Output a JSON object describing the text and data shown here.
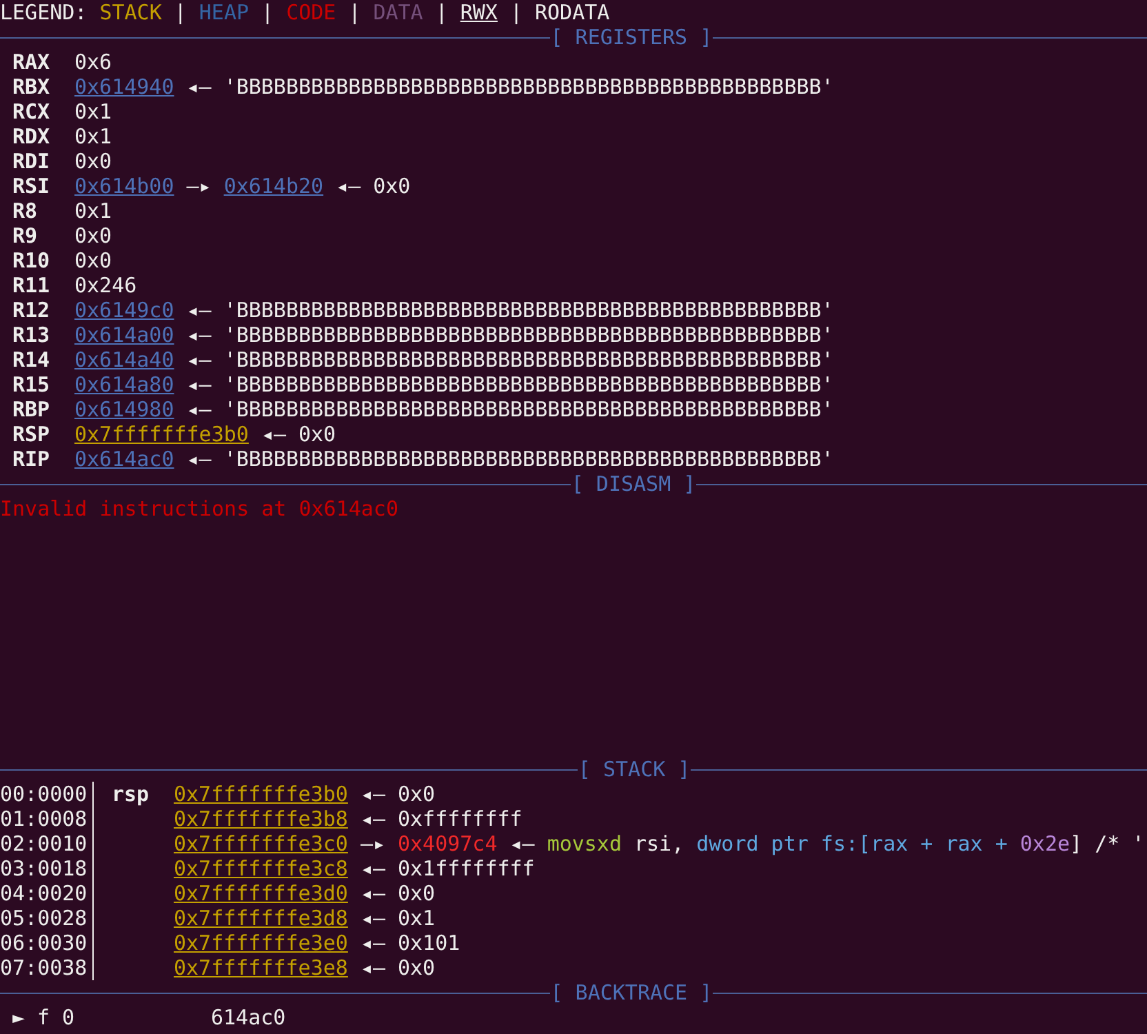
{
  "legend": {
    "label": "LEGEND:",
    "items": [
      {
        "text": "STACK",
        "kind": "stack"
      },
      {
        "text": "|",
        "kind": "sep"
      },
      {
        "text": "HEAP",
        "kind": "heap"
      },
      {
        "text": "|",
        "kind": "sep"
      },
      {
        "text": "CODE",
        "kind": "code"
      },
      {
        "text": "|",
        "kind": "sep"
      },
      {
        "text": "DATA",
        "kind": "data"
      },
      {
        "text": "|",
        "kind": "sep"
      },
      {
        "text": "RWX",
        "kind": "rwx"
      },
      {
        "text": "|",
        "kind": "sep"
      },
      {
        "text": "RODATA",
        "kind": "rodata"
      }
    ]
  },
  "registers": {
    "title": "[ REGISTERS ]",
    "rows": [
      {
        "name": "RAX",
        "chain": [
          {
            "text": "0x6",
            "kind": "plain"
          }
        ]
      },
      {
        "name": "RBX",
        "chain": [
          {
            "text": "0x614940",
            "kind": "heap"
          },
          {
            "text": "◂—",
            "kind": "arrow"
          },
          {
            "text": "'BBBBBBBBBBBBBBBBBBBBBBBBBBBBBBBBBBBBBBBBBBBBBBB'",
            "kind": "plain"
          }
        ]
      },
      {
        "name": "RCX",
        "chain": [
          {
            "text": "0x1",
            "kind": "plain"
          }
        ]
      },
      {
        "name": "RDX",
        "chain": [
          {
            "text": "0x1",
            "kind": "plain"
          }
        ]
      },
      {
        "name": "RDI",
        "chain": [
          {
            "text": "0x0",
            "kind": "plain"
          }
        ]
      },
      {
        "name": "RSI",
        "chain": [
          {
            "text": "0x614b00",
            "kind": "heap"
          },
          {
            "text": "—▸",
            "kind": "arrow"
          },
          {
            "text": "0x614b20",
            "kind": "heap"
          },
          {
            "text": "◂—",
            "kind": "arrow"
          },
          {
            "text": "0x0",
            "kind": "plain"
          }
        ]
      },
      {
        "name": "R8",
        "chain": [
          {
            "text": "0x1",
            "kind": "plain"
          }
        ]
      },
      {
        "name": "R9",
        "chain": [
          {
            "text": "0x0",
            "kind": "plain"
          }
        ]
      },
      {
        "name": "R10",
        "chain": [
          {
            "text": "0x0",
            "kind": "plain"
          }
        ]
      },
      {
        "name": "R11",
        "chain": [
          {
            "text": "0x246",
            "kind": "plain"
          }
        ]
      },
      {
        "name": "R12",
        "chain": [
          {
            "text": "0x6149c0",
            "kind": "heap"
          },
          {
            "text": "◂—",
            "kind": "arrow"
          },
          {
            "text": "'BBBBBBBBBBBBBBBBBBBBBBBBBBBBBBBBBBBBBBBBBBBBBBB'",
            "kind": "plain"
          }
        ]
      },
      {
        "name": "R13",
        "chain": [
          {
            "text": "0x614a00",
            "kind": "heap"
          },
          {
            "text": "◂—",
            "kind": "arrow"
          },
          {
            "text": "'BBBBBBBBBBBBBBBBBBBBBBBBBBBBBBBBBBBBBBBBBBBBBBB'",
            "kind": "plain"
          }
        ]
      },
      {
        "name": "R14",
        "chain": [
          {
            "text": "0x614a40",
            "kind": "heap"
          },
          {
            "text": "◂—",
            "kind": "arrow"
          },
          {
            "text": "'BBBBBBBBBBBBBBBBBBBBBBBBBBBBBBBBBBBBBBBBBBBBBBB'",
            "kind": "plain"
          }
        ]
      },
      {
        "name": "R15",
        "chain": [
          {
            "text": "0x614a80",
            "kind": "heap"
          },
          {
            "text": "◂—",
            "kind": "arrow"
          },
          {
            "text": "'BBBBBBBBBBBBBBBBBBBBBBBBBBBBBBBBBBBBBBBBBBBBBBB'",
            "kind": "plain"
          }
        ]
      },
      {
        "name": "RBP",
        "chain": [
          {
            "text": "0x614980",
            "kind": "heap"
          },
          {
            "text": "◂—",
            "kind": "arrow"
          },
          {
            "text": "'BBBBBBBBBBBBBBBBBBBBBBBBBBBBBBBBBBBBBBBBBBBBBBB'",
            "kind": "plain"
          }
        ]
      },
      {
        "name": "RSP",
        "chain": [
          {
            "text": "0x7fffffffe3b0",
            "kind": "stack"
          },
          {
            "text": "◂—",
            "kind": "arrow"
          },
          {
            "text": "0x0",
            "kind": "plain"
          }
        ]
      },
      {
        "name": "RIP",
        "chain": [
          {
            "text": "0x614ac0",
            "kind": "heap"
          },
          {
            "text": "◂—",
            "kind": "arrow"
          },
          {
            "text": "'BBBBBBBBBBBBBBBBBBBBBBBBBBBBBBBBBBBBBBBBBBBBBBB'",
            "kind": "plain"
          }
        ]
      }
    ]
  },
  "disasm": {
    "title": "[ DISASM ]",
    "message": "Invalid instructions at 0x614ac0"
  },
  "stack": {
    "title": "[ STACK ]",
    "rows": [
      {
        "index": "00:0000",
        "label": "rsp",
        "chain": [
          {
            "text": "0x7fffffffe3b0",
            "kind": "stack"
          },
          {
            "text": "◂—",
            "kind": "arrow"
          },
          {
            "text": "0x0",
            "kind": "plain"
          }
        ]
      },
      {
        "index": "01:0008",
        "chain": [
          {
            "text": "0x7fffffffe3b8",
            "kind": "stack"
          },
          {
            "text": "◂—",
            "kind": "arrow"
          },
          {
            "text": "0xffffffff",
            "kind": "plain"
          }
        ]
      },
      {
        "index": "02:0010",
        "chain": [
          {
            "text": "0x7fffffffe3c0",
            "kind": "stack"
          },
          {
            "text": "—▸",
            "kind": "arrow"
          },
          {
            "text": "0x4097c4",
            "kind": "code"
          },
          {
            "text": "◂—",
            "kind": "arrow"
          },
          {
            "text": "movsxd",
            "kind": "mnemonic"
          },
          {
            "text": "rsi,",
            "kind": "plain"
          },
          {
            "text": "dword ptr fs:[rax + rax +",
            "kind": "operand"
          },
          {
            "text": "0x2e",
            "kind": "number"
          },
          {
            "text": "] /* '",
            "kind": "plain",
            "attached": true
          }
        ]
      },
      {
        "index": "03:0018",
        "chain": [
          {
            "text": "0x7fffffffe3c8",
            "kind": "stack"
          },
          {
            "text": "◂—",
            "kind": "arrow"
          },
          {
            "text": "0x1ffffffff",
            "kind": "plain"
          }
        ]
      },
      {
        "index": "04:0020",
        "chain": [
          {
            "text": "0x7fffffffe3d0",
            "kind": "stack"
          },
          {
            "text": "◂—",
            "kind": "arrow"
          },
          {
            "text": "0x0",
            "kind": "plain"
          }
        ]
      },
      {
        "index": "05:0028",
        "chain": [
          {
            "text": "0x7fffffffe3d8",
            "kind": "stack"
          },
          {
            "text": "◂—",
            "kind": "arrow"
          },
          {
            "text": "0x1",
            "kind": "plain"
          }
        ]
      },
      {
        "index": "06:0030",
        "chain": [
          {
            "text": "0x7fffffffe3e0",
            "kind": "stack"
          },
          {
            "text": "◂—",
            "kind": "arrow"
          },
          {
            "text": "0x101",
            "kind": "plain"
          }
        ]
      },
      {
        "index": "07:0038",
        "chain": [
          {
            "text": "0x7fffffffe3e8",
            "kind": "stack"
          },
          {
            "text": "◂—",
            "kind": "arrow"
          },
          {
            "text": "0x0",
            "kind": "plain"
          }
        ]
      }
    ]
  },
  "backtrace": {
    "title": "[ BACKTRACE ]",
    "frames": [
      {
        "marker": "►",
        "frame": "f 0",
        "address": "614ac0"
      }
    ]
  }
}
